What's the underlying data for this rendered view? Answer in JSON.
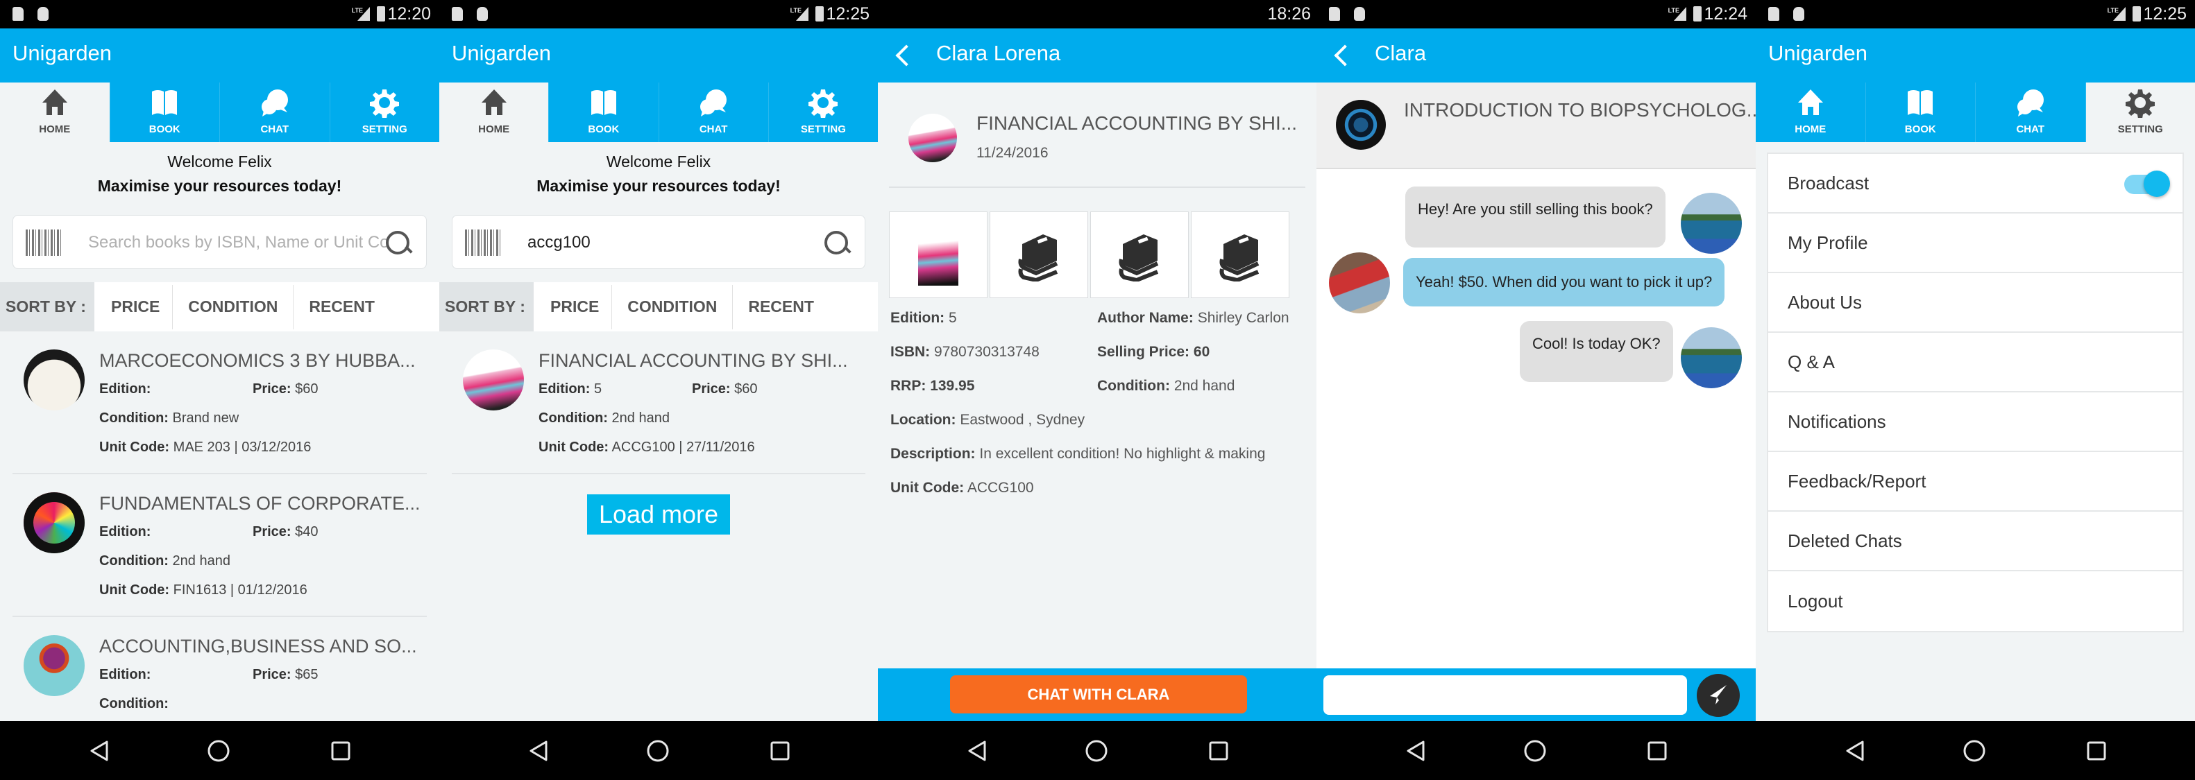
{
  "colors": {
    "primary": "#00aced",
    "accent_orange": "#f76b1f",
    "incoming_bubble": "#8dcfe9",
    "outgoing_bubble": "#e0e0e0"
  },
  "tabs": [
    {
      "label": "HOME",
      "icon": "home-icon"
    },
    {
      "label": "BOOK",
      "icon": "book-icon"
    },
    {
      "label": "CHAT",
      "icon": "chat-icon"
    },
    {
      "label": "SETTING",
      "icon": "gear-icon"
    }
  ],
  "home1": {
    "clock": "12:20",
    "app_title": "Unigarden",
    "welcome": "Welcome Felix",
    "tagline": "Maximise your resources today!",
    "search_placeholder": "Search books by ISBN, Name or Unit Code",
    "search_value": "",
    "sort_label": "SORT BY :",
    "sort_options": [
      "PRICE",
      "CONDITION",
      "RECENT"
    ],
    "labels": {
      "edition": "Edition:",
      "price": "Price:",
      "condition": "Condition:",
      "unit_code": "Unit Code:"
    },
    "books": [
      {
        "title": "MARCOECONOMICS 3 BY HUBBA...",
        "edition": "",
        "price": "$60",
        "condition": "Brand new",
        "unit": "MAE 203 | 03/12/2016"
      },
      {
        "title": "FUNDAMENTALS OF CORPORATE...",
        "edition": "",
        "price": "$40",
        "condition": "2nd hand",
        "unit": "FIN1613 | 01/12/2016"
      },
      {
        "title": "ACCOUNTING,BUSINESS AND SO...",
        "edition": "",
        "price": "$65",
        "condition": "",
        "unit": ""
      }
    ]
  },
  "home2": {
    "clock": "12:25",
    "app_title": "Unigarden",
    "welcome": "Welcome Felix",
    "tagline": "Maximise your resources today!",
    "search_value": "accg100",
    "sort_label": "SORT BY :",
    "sort_options": [
      "PRICE",
      "CONDITION",
      "RECENT"
    ],
    "labels": {
      "edition": "Edition:",
      "price": "Price:",
      "condition": "Condition:",
      "unit_code": "Unit Code:"
    },
    "books": [
      {
        "title": "FINANCIAL ACCOUNTING BY SHI...",
        "edition": "5",
        "price": "$60",
        "condition": "2nd hand",
        "unit": "ACCG100 | 27/11/2016"
      }
    ],
    "load_more": "Load more"
  },
  "detail": {
    "clock": "18:26",
    "seller": "Clara Lorena",
    "title": "FINANCIAL ACCOUNTING BY SHI...",
    "date": "11/24/2016",
    "fields": {
      "edition_label": "Edition:",
      "edition": "5",
      "author_label": "Author Name:",
      "author": "Shirley Carlon",
      "isbn_label": "ISBN:",
      "isbn": "9780730313748",
      "selling_label": "Selling Price:",
      "selling": "60",
      "rrp_label": "RRP:",
      "rrp": "139.95",
      "condition_label": "Condition:",
      "condition": "2nd hand",
      "location_label": "Location:",
      "location": "Eastwood , Sydney",
      "description_label": "Description:",
      "description": "In excellent condition! No highlight & making",
      "unit_label": "Unit Code:",
      "unit": "ACCG100"
    },
    "chat_button": "CHAT WITH CLARA"
  },
  "chat": {
    "clock": "12:24",
    "contact": "Clara",
    "book_title": "INTRODUCTION TO BIOPSYCHOLOG...",
    "messages": [
      {
        "from": "me",
        "text": "Hey! Are you still selling this book?"
      },
      {
        "from": "clara",
        "text": "Yeah! $50. When did you want to pick it up?"
      },
      {
        "from": "me",
        "text": "Cool! Is today OK?"
      }
    ],
    "input_value": ""
  },
  "settings": {
    "clock": "12:25",
    "app_title": "Unigarden",
    "broadcast_label": "Broadcast",
    "broadcast_on": true,
    "items": [
      "My Profile",
      "About Us",
      "Q & A",
      "Notifications",
      "Feedback/Report",
      "Deleted Chats",
      "Logout"
    ]
  }
}
